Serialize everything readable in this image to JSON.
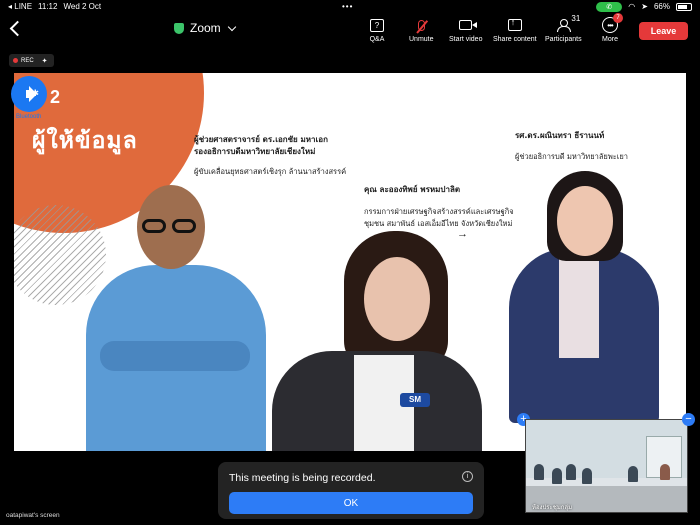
{
  "status_bar": {
    "carrier": "◂ LINE",
    "time": "11:12",
    "date": "Wed 2 Oct",
    "center_dots": "•••",
    "battery": "66%",
    "call_icon": "phone-icon",
    "wifi_icon": "wifi-icon"
  },
  "toolbar": {
    "title": "Zoom",
    "buttons": [
      {
        "label": "Q&A",
        "icon": "qa-icon"
      },
      {
        "label": "Unmute",
        "icon": "mic-muted-icon"
      },
      {
        "label": "Start video",
        "icon": "video-icon"
      },
      {
        "label": "Share content",
        "icon": "share-icon"
      },
      {
        "label": "Participants",
        "icon": "participants-icon",
        "count": "31"
      },
      {
        "label": "More",
        "icon": "more-icon",
        "badge": "7"
      }
    ],
    "leave_label": "Leave",
    "qa_glyph": "?",
    "more_glyph": "•••"
  },
  "rec": {
    "label": "REC",
    "spark": "✦"
  },
  "bluetooth": {
    "label": "Bluetooth",
    "symbol": "✱"
  },
  "slide": {
    "number": "2",
    "heading": "ผู้ให้ข้อมูล",
    "person1_title": "ผู้ช่วยศาสตราจารย์ ดร.เอกชัย มหาเอก",
    "person1_role": "รองอธิการบดีมหาวิทยาลัยเชียงใหม่",
    "person1_desc": "ผู้ขับเคลื่อนยุทธศาสตร์เชิงรุก ล้านนาสร้างสรรค์",
    "person2_title": "คุณ ละอองทิพย์ พรหมปาลิต",
    "person2_desc1": "กรรมการฝ่ายเศรษฐกิจสร้างสรรค์และเศรษฐกิจ",
    "person2_desc2": "ชุมชน สมาพันธ์ เอสเอ็มอีไทย จังหวัดเชียงใหม่",
    "person3_title": "รศ.ดร.ผณินทรา ธีรานนท์",
    "person3_role": "ผู้ช่วยอธิการบดี มหาวิทยาลัยพะเยา",
    "arrow": "→",
    "shirt_logo": "SM"
  },
  "toast": {
    "message": "This meeting is being recorded.",
    "ok_label": "OK",
    "info_glyph": "i"
  },
  "thumbnail": {
    "caption": "ห้องประชุมกลุ่ม",
    "plus": "+",
    "minus": "−"
  },
  "screen_label": "oatapiwat's screen"
}
